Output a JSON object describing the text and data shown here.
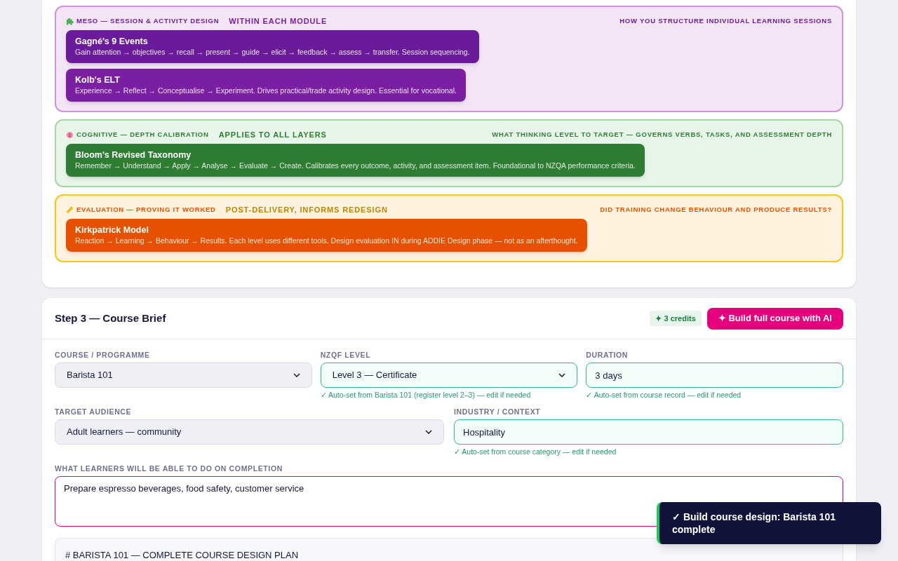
{
  "framework_layers": [
    {
      "kind": "meso",
      "label": "MESO — SESSION & ACTIVITY DESIGN",
      "scope": "WITHIN EACH MODULE",
      "question": "HOW YOU STRUCTURE INDIVIDUAL LEARNING SESSIONS",
      "models": [
        {
          "name": "Gagné's 9 Events",
          "description": "Gain attention → objectives → recall → present → guide → elicit → feedback → assess → transfer. Session sequencing.",
          "color": "#6a1b9a"
        },
        {
          "name": "Kolb's ELT",
          "description": "Experience → Reflect → Conceptualise → Experiment. Drives practical/trade activity design. Essential for vocational.",
          "color": "#7b1fa2"
        }
      ]
    },
    {
      "kind": "cognitive",
      "label": "COGNITIVE — DEPTH CALIBRATION",
      "scope": "APPLIES TO ALL LAYERS",
      "question": "WHAT THINKING LEVEL TO TARGET — GOVERNS VERBS, TASKS, AND ASSESSMENT DEPTH",
      "models": [
        {
          "name": "Bloom's Revised Taxonomy",
          "description": "Remember → Understand → Apply → Analyse → Evaluate → Create. Calibrates every outcome, activity, and assessment item. Foundational to NZQA performance criteria.",
          "color": "#2e7d32"
        }
      ]
    },
    {
      "kind": "evaluation",
      "label": "EVALUATION — PROVING IT WORKED",
      "scope": "POST-DELIVERY, INFORMS REDESIGN",
      "question": "DID TRAINING CHANGE BEHAVIOUR AND PRODUCE RESULTS?",
      "models": [
        {
          "name": "Kirkpatrick Model",
          "description": "Reaction → Learning → Behaviour → Results. Each level uses different tools. Design evaluation IN during ADDIE Design phase — not as an afterthought.",
          "color": "#e65100"
        }
      ]
    }
  ],
  "course_brief": {
    "title": "Step 3 — Course Brief",
    "credits_badge": "✦ 3 credits",
    "build_button": "✦ Build full course with AI",
    "rows": [
      [
        {
          "kind": "select",
          "label": "COURSE / PROGRAMME",
          "value": "Barista 101",
          "auto_set": false
        },
        {
          "kind": "select",
          "label": "NZQF LEVEL",
          "value": "Level 3 — Certificate",
          "auto_set": true,
          "hint": "✓ Auto-set from Barista 101 (register level 2–3) — edit if needed"
        },
        {
          "kind": "text",
          "label": "DURATION",
          "value": "3 days",
          "auto_set": true,
          "hint": "✓ Auto-set from course record — edit if needed"
        }
      ],
      [
        {
          "kind": "select",
          "label": "TARGET AUDIENCE",
          "value": "Adult learners — community",
          "auto_set": false
        },
        {
          "kind": "text",
          "label": "INDUSTRY / CONTEXT",
          "value": "Hospitality",
          "auto_set": true,
          "hint": "✓ Auto-set from course category — edit if needed"
        }
      ]
    ],
    "outcomes": {
      "label": "WHAT LEARNERS WILL BE ABLE TO DO ON COMPLETION",
      "value": "Prepare espresso beverages, food safety, customer service",
      "focused": true
    },
    "plan_preview": "# BARISTA 101 — COMPLETE COURSE DESIGN PLAN"
  },
  "toast": {
    "message": "✓ Build course design: Barista 101 complete"
  }
}
